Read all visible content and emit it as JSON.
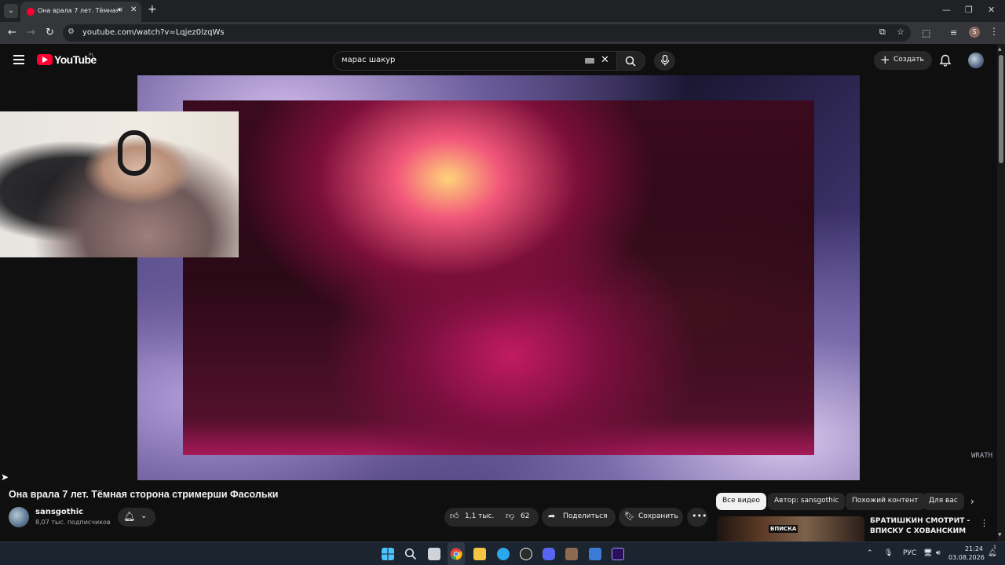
{
  "browser": {
    "tab_title": "Она врала 7 лет. Тёмная сторона стримерши Фасольки",
    "url": "youtube.com/watch?v=Lqjez0lzqWs",
    "profile_initial": "S"
  },
  "youtube": {
    "logo_text": "YouTube",
    "region": "PL",
    "search_value": "марас шакур",
    "create_label": "Создать"
  },
  "video": {
    "watermark": "WRATH",
    "title": "Она врала 7 лет. Тёмная сторона стримерши Фасольки",
    "channel_name": "sansgothic",
    "subscribers": "8,07 тыс. подписчиков",
    "likes": "1,1 тыс.",
    "dislikes": "62",
    "share_label": "Поделиться",
    "save_label": "Сохранить"
  },
  "chips": [
    "Все видео",
    "Автор: sansgothic",
    "Похожий контент",
    "Для вас"
  ],
  "recommendation": {
    "title": "БРАТИШКИН СМОТРИТ - ВПИСКУ С ХОВАНСКИМ",
    "thumb_text": "ВПИСКА"
  },
  "taskbar": {
    "language": "РУС",
    "time": "21:24",
    "date": "03.08.2026",
    "badge": "1"
  },
  "colors": {
    "yt_red": "#ff0033",
    "background": "#0f0f0f",
    "chip_active": "#f1f1f1"
  }
}
